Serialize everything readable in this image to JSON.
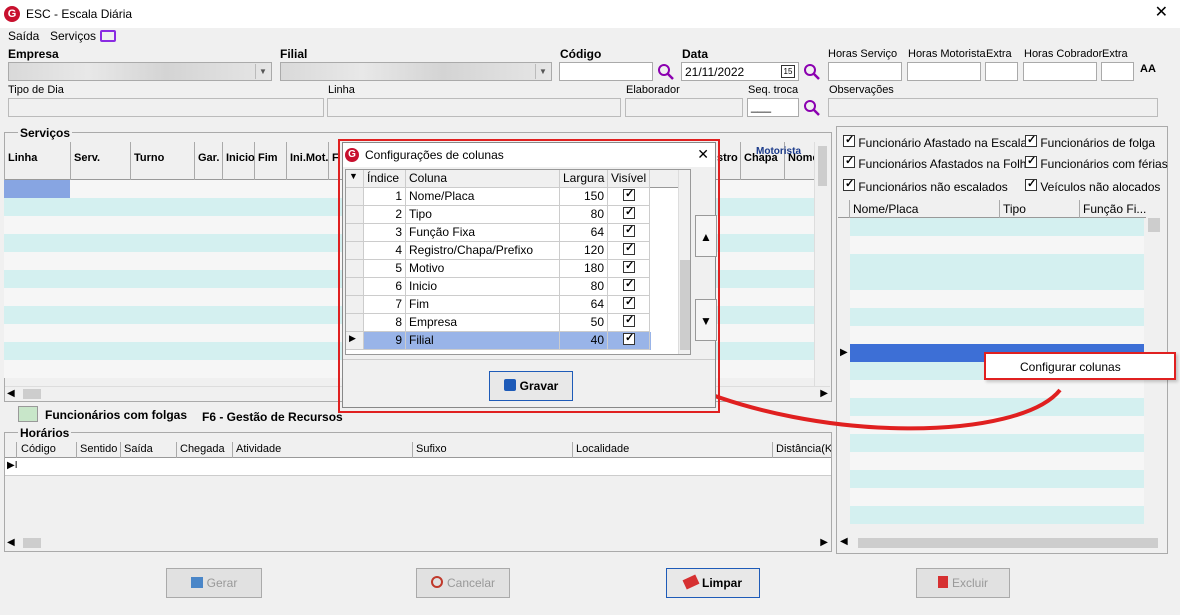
{
  "window": {
    "title": "ESC - Escala Diária",
    "app_icon": "G"
  },
  "menu": [
    "Saída",
    "Serviços"
  ],
  "header": {
    "empresa_label": "Empresa",
    "filial_label": "Filial",
    "codigo_label": "Código",
    "data_label": "Data",
    "data_value": "21/11/2022",
    "horas_servico": "Horas Serviço",
    "horas_motorista": "Horas Motorista",
    "extra1": "Extra",
    "horas_cobrador": "Horas Cobrador",
    "extra2": "Extra",
    "tipo_dia": "Tipo de Dia",
    "linha": "Linha",
    "elaborador": "Elaborador",
    "seq_troca": "Seq. troca",
    "seq_troca_value": "___",
    "observacoes": "Observações",
    "font_icon": "AA"
  },
  "servicos": {
    "section": "Serviços",
    "columns": [
      "Linha",
      "Serv.",
      "Turno",
      "Gar.",
      "Inicio",
      "Fim",
      "Ini.Mot.",
      "F"
    ],
    "right_columns": [
      "stro",
      "Chapa",
      "Nome"
    ],
    "motorista_label": "Motorista"
  },
  "legend": {
    "folgas": "Funcionários com folgas",
    "f6": "F6 - Gestão de Recursos"
  },
  "horarios": {
    "section": "Horários",
    "columns": [
      "Código",
      "Sentido",
      "Saída",
      "Chegada",
      "Atividade",
      "Sufixo",
      "Localidade",
      "Distância(K"
    ]
  },
  "right_panel": {
    "filters": [
      {
        "label": "Funcionário Afastado na Escala",
        "checked": true
      },
      {
        "label": "Funcionários de folga",
        "checked": true
      },
      {
        "label": "Funcionários Afastados na Folha",
        "checked": true
      },
      {
        "label": "Funcionários com férias",
        "checked": true
      },
      {
        "label": "Funcionários não escalados",
        "checked": true
      },
      {
        "label": "Veículos não alocados",
        "checked": true
      }
    ],
    "columns": [
      "Nome/Placa",
      "Tipo",
      "Função Fi..."
    ]
  },
  "context_menu": {
    "item": "Configurar colunas"
  },
  "dialog": {
    "title": "Configurações de colunas",
    "columns": [
      "Índice",
      "Coluna",
      "Largura",
      "Visível"
    ],
    "rows": [
      {
        "indice": "1",
        "coluna": "Nome/Placa",
        "largura": "150",
        "visivel": true
      },
      {
        "indice": "2",
        "coluna": "Tipo",
        "largura": "80",
        "visivel": true
      },
      {
        "indice": "3",
        "coluna": "Função Fixa",
        "largura": "64",
        "visivel": true
      },
      {
        "indice": "4",
        "coluna": "Registro/Chapa/Prefixo",
        "largura": "120",
        "visivel": true
      },
      {
        "indice": "5",
        "coluna": "Motivo",
        "largura": "180",
        "visivel": true
      },
      {
        "indice": "6",
        "coluna": "Inicio",
        "largura": "80",
        "visivel": true
      },
      {
        "indice": "7",
        "coluna": "Fim",
        "largura": "64",
        "visivel": true
      },
      {
        "indice": "8",
        "coluna": "Empresa",
        "largura": "50",
        "visivel": true
      },
      {
        "indice": "9",
        "coluna": "Filial",
        "largura": "40",
        "visivel": true
      }
    ],
    "save_button": "Gravar"
  },
  "buttons": {
    "gerar": "Gerar",
    "cancelar": "Cancelar",
    "limpar": "Limpar",
    "excluir": "Excluir"
  },
  "colors": {
    "highlight_frame": "#e02020",
    "selected_row": "#99b4e8",
    "cyan_row": "#d4f0f0"
  }
}
